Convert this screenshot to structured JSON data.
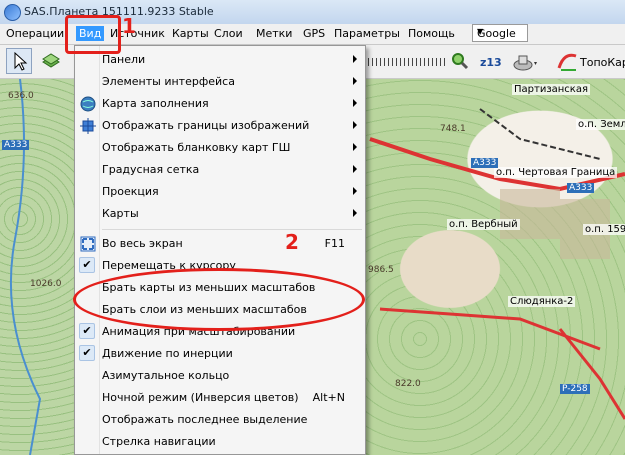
{
  "window": {
    "title": "SAS.Планета 151111.9233 Stable"
  },
  "menubar": {
    "items": [
      {
        "label": "Операции"
      },
      {
        "label": "Вид"
      },
      {
        "label": "Источник"
      },
      {
        "label": "Карты"
      },
      {
        "label": "Слои"
      },
      {
        "label": "Метки"
      },
      {
        "label": "GPS"
      },
      {
        "label": "Параметры"
      },
      {
        "label": "Помощь"
      }
    ],
    "map_source_combo": "Google"
  },
  "toolbar": {
    "zoom_level": "z13",
    "topo_label": "ТопоКарт"
  },
  "map": {
    "labels": {
      "place1": "Партизанская",
      "place2": "о.п. Чертовая Граница",
      "place3": "о.п. Вербный",
      "place4": "Слюдянка-2",
      "place5": "о.п. Земл",
      "place6": "о.п. 159"
    },
    "roads": {
      "a333_left": "A333",
      "a333_mid": "A333",
      "a333_right": "A333",
      "p258": "P-258"
    },
    "elevations": {
      "e1": "636.0",
      "e2": "986.5",
      "e3": "822.0",
      "e4": "748.1",
      "e5": "1026.0"
    }
  },
  "view_menu": {
    "items": [
      {
        "label": "Панели",
        "submenu": true
      },
      {
        "label": "Элементы интерфейса",
        "submenu": true
      },
      {
        "label": "Карта заполнения",
        "submenu": true,
        "icon": "globe-icon"
      },
      {
        "label": "Отображать границы изображений",
        "submenu": true,
        "icon": "image-bounds-icon"
      },
      {
        "label": "Отображать бланковку карт ГШ",
        "submenu": true
      },
      {
        "label": "Градусная сетка",
        "submenu": true
      },
      {
        "label": "Проекция",
        "submenu": true
      },
      {
        "label": "Карты",
        "submenu": true
      },
      {
        "label": "Во весь экран",
        "shortcut": "F11",
        "icon": "fullscreen-icon"
      },
      {
        "label": "Перемещать к курсору",
        "checked": true
      },
      {
        "label": "Брать карты из меньших масштабов"
      },
      {
        "label": "Брать слои из меньших масштабов"
      },
      {
        "label": "Анимация при масштабировании",
        "checked": true
      },
      {
        "label": "Движение по инерции",
        "checked": true
      },
      {
        "label": "Азимутальное кольцо"
      },
      {
        "label": "Ночной режим (Инверсия цветов)",
        "shortcut": "Alt+N"
      },
      {
        "label": "Отображать последнее выделение"
      },
      {
        "label": "Стрелка навигации"
      }
    ]
  },
  "annotations": {
    "step1": "1",
    "step2": "2"
  },
  "colors": {
    "annotation_red": "#e3201b",
    "menu_highlight": "#3399ff"
  }
}
